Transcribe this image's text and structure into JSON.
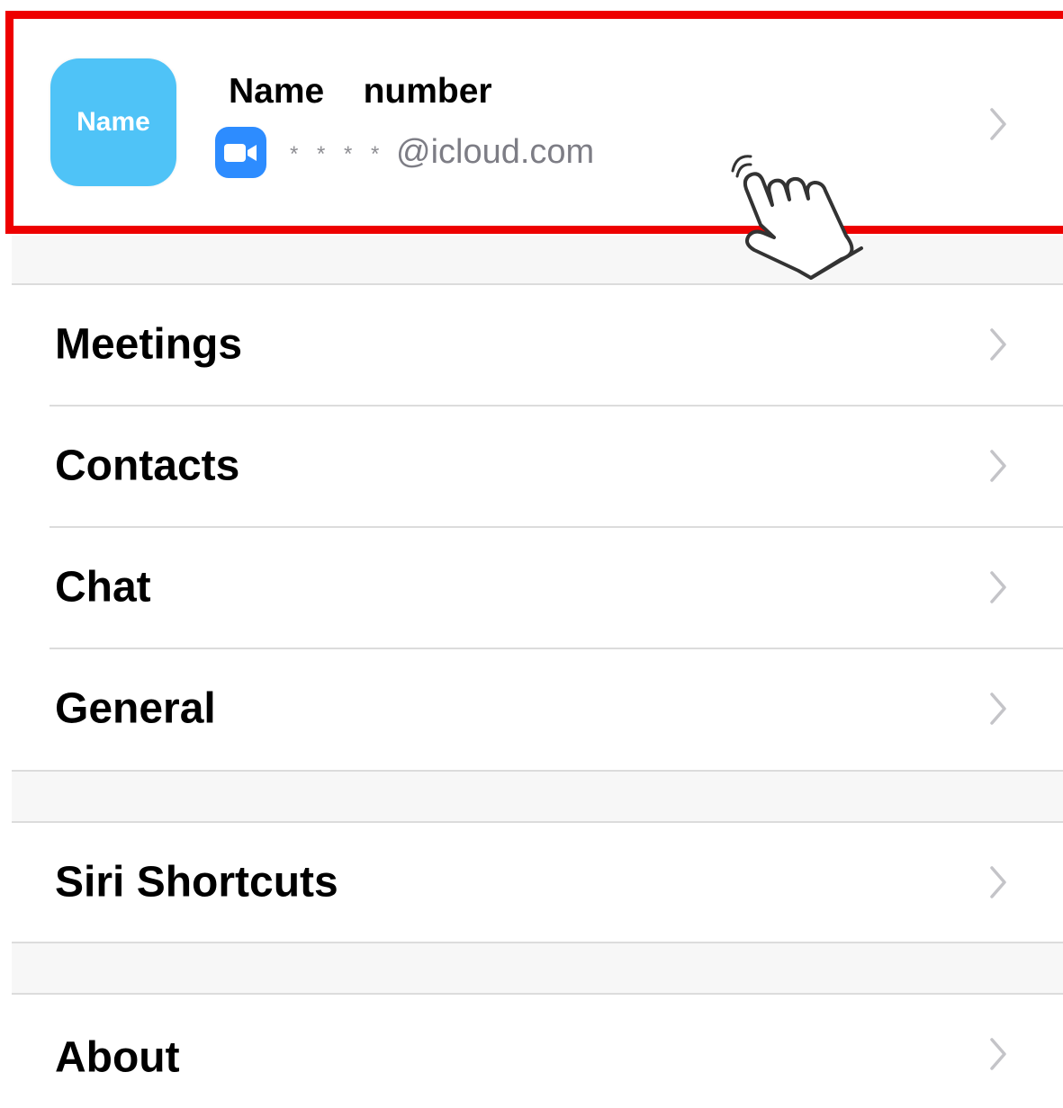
{
  "profile": {
    "avatar_text": "Name",
    "display_name": "Name    number",
    "masked_account": "* * * *",
    "email_domain": "@icloud.com"
  },
  "menu": {
    "meetings": "Meetings",
    "contacts": "Contacts",
    "chat": "Chat",
    "general": "General",
    "siri": "Siri Shortcuts",
    "about": "About"
  },
  "icons": {
    "zoom": "video-camera-icon",
    "chevron": "chevron-right-icon",
    "pointer": "tap-hand-icon"
  },
  "colors": {
    "highlight": "#ee0000",
    "avatar": "#4fc3f7",
    "zoom_blue": "#2d8cff"
  }
}
